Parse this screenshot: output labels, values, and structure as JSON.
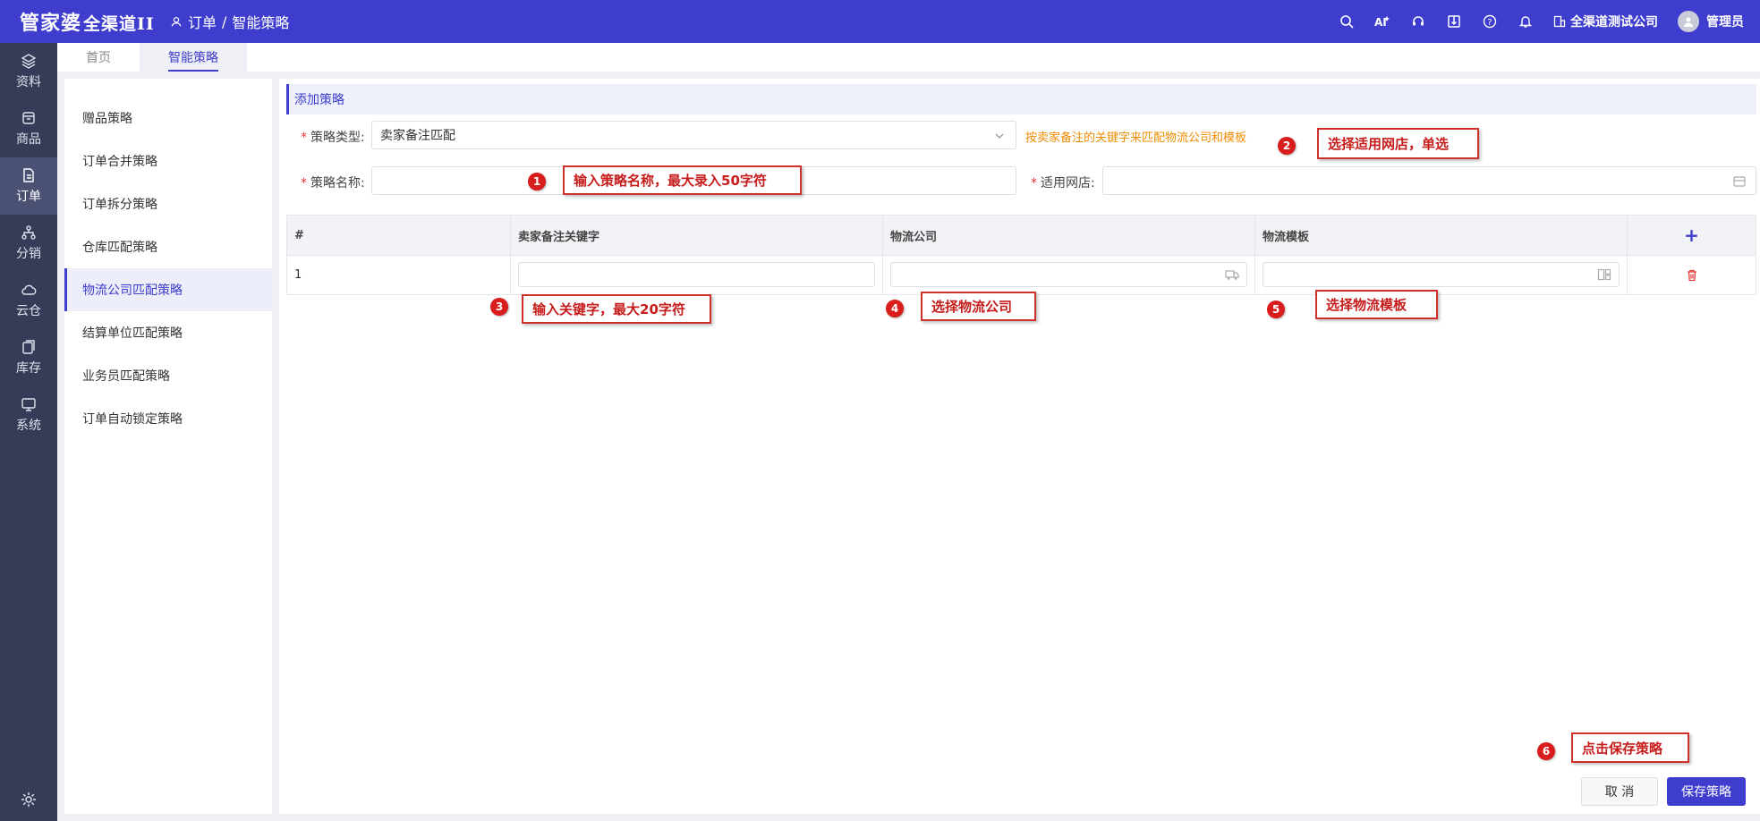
{
  "header": {
    "logo_main": "管家婆",
    "logo_sub": "全渠道II",
    "breadcrumb": [
      "订单",
      "/",
      "智能策略"
    ],
    "company": "全渠道测试公司",
    "user": "管理员",
    "icons": [
      "search-icon",
      "ai-icon",
      "headset-icon",
      "book-icon",
      "help-icon",
      "bell-icon"
    ]
  },
  "rail": {
    "items": [
      {
        "label": "资料",
        "icon": "layers-icon"
      },
      {
        "label": "商品",
        "icon": "box-icon"
      },
      {
        "label": "订单",
        "icon": "order-icon"
      },
      {
        "label": "分销",
        "icon": "network-icon"
      },
      {
        "label": "云仓",
        "icon": "cloud-icon"
      },
      {
        "label": "库存",
        "icon": "stock-icon"
      },
      {
        "label": "系统",
        "icon": "monitor-icon"
      }
    ],
    "active": "订单"
  },
  "tabs": [
    {
      "label": "首页"
    },
    {
      "label": "智能策略"
    }
  ],
  "menu": {
    "items": [
      "赠品策略",
      "订单合并策略",
      "订单拆分策略",
      "仓库匹配策略",
      "物流公司匹配策略",
      "结算单位匹配策略",
      "业务员匹配策略",
      "订单自动锁定策略"
    ],
    "active": "物流公司匹配策略"
  },
  "form": {
    "title": "添加策略",
    "type_label": "策略类型:",
    "type_value": "卖家备注匹配",
    "type_hint": "按卖家备注的关键字来匹配物流公司和模板",
    "name_label": "策略名称:",
    "name_value": "",
    "shop_label": "适用网店:",
    "shop_value": ""
  },
  "table": {
    "headers": [
      "#",
      "卖家备注关键字",
      "物流公司",
      "物流模板",
      "+"
    ],
    "rows": [
      {
        "index": "1",
        "keyword": "",
        "company": "",
        "template": ""
      }
    ]
  },
  "annotations": [
    {
      "num": "1",
      "text": "输入策略名称，最大录入50字符"
    },
    {
      "num": "2",
      "text": "选择适用网店，单选"
    },
    {
      "num": "3",
      "text": "输入关键字，最大20字符"
    },
    {
      "num": "4",
      "text": "选择物流公司"
    },
    {
      "num": "5",
      "text": "选择物流模板"
    },
    {
      "num": "6",
      "text": "点击保存策略"
    }
  ],
  "buttons": {
    "cancel": "取 消",
    "save": "保存策略"
  },
  "colors": {
    "brand": "#3e3dce",
    "rail": "#363c57",
    "hint": "#f08c00",
    "annotation": "#d0302a",
    "delete": "#e53935"
  }
}
